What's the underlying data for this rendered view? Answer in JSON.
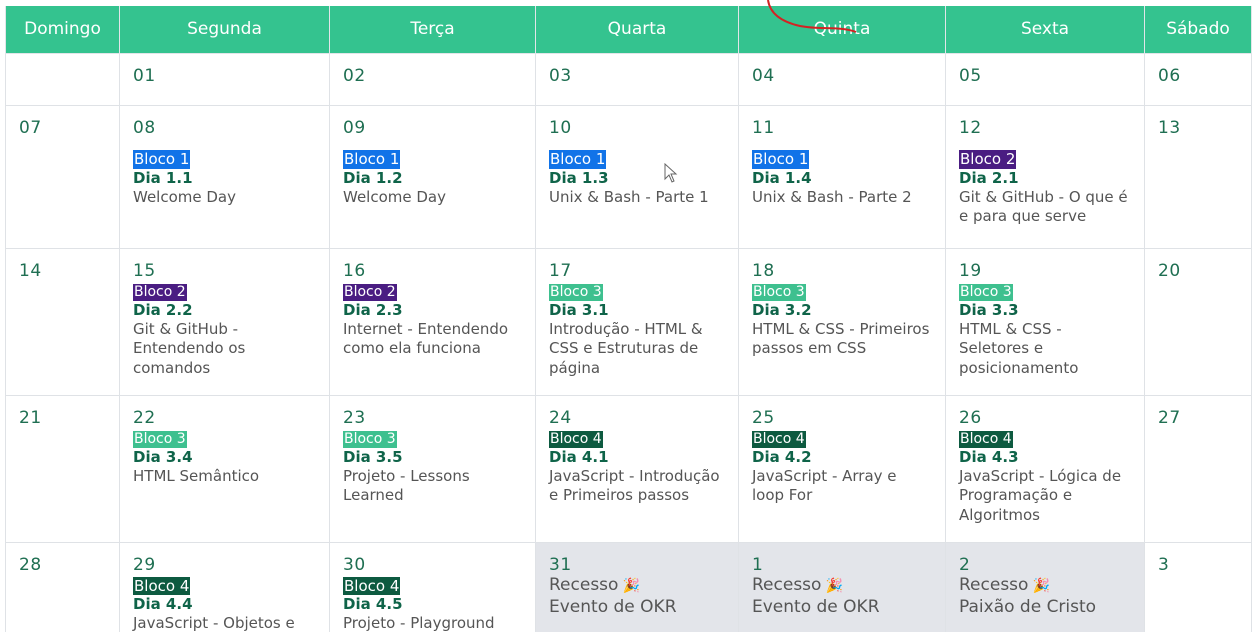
{
  "weekdays": [
    "Domingo",
    "Segunda",
    "Terça",
    "Quarta",
    "Quinta",
    "Sexta",
    "Sábado"
  ],
  "colors": {
    "header": "#34c38f",
    "bloco_1": "#1173e8",
    "bloco_2": "#4a1d82",
    "bloco_3": "#3ec08f",
    "bloco_4": "#0d5a40",
    "recess_bg": "#e3e5ea",
    "annotation": "#d22323"
  },
  "weeks": [
    [
      {
        "day": ""
      },
      {
        "day": "01"
      },
      {
        "day": "02"
      },
      {
        "day": "03"
      },
      {
        "day": "04"
      },
      {
        "day": "05"
      },
      {
        "day": "06"
      }
    ],
    [
      {
        "day": "07"
      },
      {
        "day": "08",
        "bloco": "Bloco 1",
        "dia": "Dia 1.1",
        "desc": "Welcome Day"
      },
      {
        "day": "09",
        "bloco": "Bloco 1",
        "dia": "Dia 1.2",
        "desc": "Welcome Day"
      },
      {
        "day": "10",
        "bloco": "Bloco 1",
        "dia": "Dia 1.3",
        "desc": "Unix & Bash - Parte 1"
      },
      {
        "day": "11",
        "bloco": "Bloco 1",
        "dia": "Dia 1.4",
        "desc": "Unix & Bash - Parte 2"
      },
      {
        "day": "12",
        "bloco": "Bloco 2",
        "dia": "Dia 2.1",
        "desc": "Git & GitHub - O que é e para que serve"
      },
      {
        "day": "13"
      }
    ],
    [
      {
        "day": "14"
      },
      {
        "day": "15",
        "bloco": "Bloco 2",
        "dia": "Dia 2.2",
        "desc": "Git & GitHub - Entendendo os comandos"
      },
      {
        "day": "16",
        "bloco": "Bloco 2",
        "dia": "Dia 2.3",
        "desc": "Internet - Entendendo como ela funciona"
      },
      {
        "day": "17",
        "bloco": "Bloco 3",
        "dia": "Dia 3.1",
        "desc": "Introdução - HTML & CSS e Estruturas de página"
      },
      {
        "day": "18",
        "bloco": "Bloco 3",
        "dia": "Dia 3.2",
        "desc": "HTML & CSS - Primeiros passos em CSS"
      },
      {
        "day": "19",
        "bloco": "Bloco 3",
        "dia": "Dia 3.3",
        "desc": "HTML & CSS - Seletores e posicionamento"
      },
      {
        "day": "20"
      }
    ],
    [
      {
        "day": "21"
      },
      {
        "day": "22",
        "bloco": "Bloco 3",
        "dia": "Dia 3.4",
        "desc": "HTML Semântico"
      },
      {
        "day": "23",
        "bloco": "Bloco 3",
        "dia": "Dia 3.5",
        "desc": "Projeto - Lessons Learned"
      },
      {
        "day": "24",
        "bloco": "Bloco 4",
        "dia": "Dia 4.1",
        "desc": "JavaScript - Introdução e Primeiros passos"
      },
      {
        "day": "25",
        "bloco": "Bloco 4",
        "dia": "Dia 4.2",
        "desc": "JavaScript - Array e loop For"
      },
      {
        "day": "26",
        "bloco": "Bloco 4",
        "dia": "Dia 4.3",
        "desc": "JavaScript - Lógica de Programação e Algoritmos"
      },
      {
        "day": "27"
      }
    ],
    [
      {
        "day": "28"
      },
      {
        "day": "29",
        "bloco": "Bloco 4",
        "dia": "Dia 4.4",
        "desc": "JavaScript - Objetos e"
      },
      {
        "day": "30",
        "bloco": "Bloco 4",
        "dia": "Dia 4.5",
        "desc": "Projeto - Playground"
      },
      {
        "day": "31",
        "recess": "Recesso",
        "note": "Evento de OKR"
      },
      {
        "day": "1",
        "recess": "Recesso",
        "note": "Evento de OKR"
      },
      {
        "day": "2",
        "recess": "Recesso",
        "note": "Paixão de Cristo"
      },
      {
        "day": "3"
      }
    ]
  ]
}
